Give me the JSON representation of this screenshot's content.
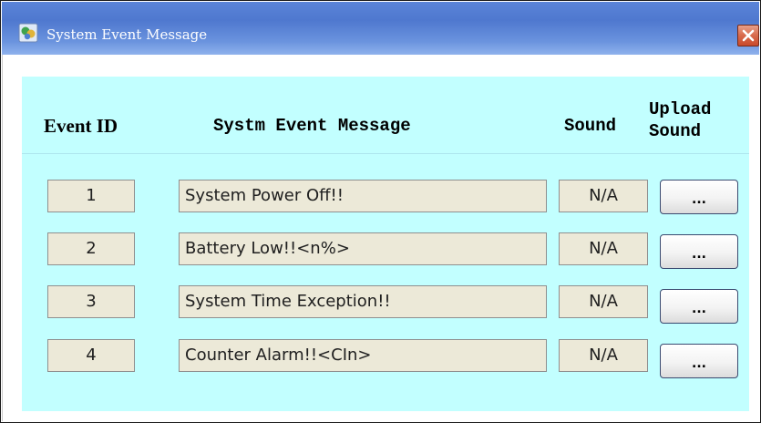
{
  "window": {
    "title": "System Event Message",
    "close_icon": "close-icon"
  },
  "table": {
    "headers": {
      "event_id": "Event ID",
      "message": "Systm Event Message",
      "sound": "Sound",
      "upload_line1": "Upload",
      "upload_line2": "Sound"
    },
    "rows": [
      {
        "id": "1",
        "message": "System Power Off!!",
        "sound": "N/A",
        "upload": "..."
      },
      {
        "id": "2",
        "message": "Battery Low!!<n%>",
        "sound": "N/A",
        "upload": "..."
      },
      {
        "id": "3",
        "message": "System Time Exception!!",
        "sound": "N/A",
        "upload": "..."
      },
      {
        "id": "4",
        "message": "Counter Alarm!!<CIn>",
        "sound": "N/A",
        "upload": "..."
      }
    ]
  },
  "colors": {
    "panel": "#c2ffff",
    "field": "#ece9d8",
    "titlebar": "#5a84d8",
    "close": "#d86a4c"
  }
}
